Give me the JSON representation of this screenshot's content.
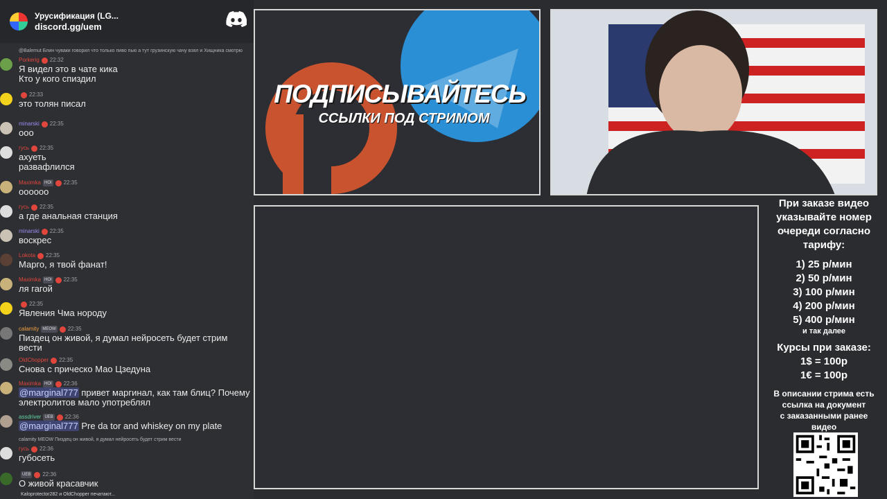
{
  "server": {
    "name": "Урусификация (LG...",
    "invite": "discord.gg/uem",
    "icon": "discord-icon"
  },
  "messages": [
    {
      "reply": "@Balemut Блин чуваки говорил что только пиво пью а тут грузинскую чачу взял и Хищника смотрю",
      "name": "Porkerig",
      "name_color": "#e0463c",
      "time": "22:32",
      "lines": [
        "Я видел это в чате кика",
        "Кто у кого спиздил"
      ]
    },
    {
      "name": "",
      "name_color": "#e6e6e6",
      "time": "22:33",
      "lines": [
        "это толян писал"
      ]
    },
    {
      "name": "minarski",
      "name_color": "#9b8cf0",
      "time": "22:35",
      "lines": [
        "ооо"
      ]
    },
    {
      "name": "гусь",
      "name_color": "#e0463c",
      "time": "22:35",
      "lines": [
        "ахуеть",
        "развафлился"
      ]
    },
    {
      "name": "Maximka",
      "name_color": "#e0463c",
      "badge": "HOI",
      "time": "22:35",
      "lines": [
        "оооооо"
      ]
    },
    {
      "name": "гусь",
      "name_color": "#e0463c",
      "time": "22:35",
      "lines": [
        "а где анальная станция"
      ]
    },
    {
      "name": "minarski",
      "name_color": "#9b8cf0",
      "time": "22:35",
      "lines": [
        "воскрес"
      ]
    },
    {
      "name": "Lokota",
      "name_color": "#e0463c",
      "time": "22:35",
      "lines": [
        "Марго, я твой фанат!"
      ]
    },
    {
      "name": "Maximka",
      "name_color": "#e0463c",
      "badge": "HOI",
      "time": "22:35",
      "lines": [
        "ля гагой"
      ]
    },
    {
      "name": "",
      "name_color": "#e6e6e6",
      "time": "22:35",
      "lines": [
        "Явления Чма нороду"
      ]
    },
    {
      "name": "calamity",
      "name_color": "#f0a040",
      "badge": "MEOW",
      "time": "22:35",
      "lines": [
        "Пиздец он живой, я думал нейросеть будет стрим",
        "вести"
      ]
    },
    {
      "name": "OldChopper",
      "name_color": "#e0463c",
      "time": "22:35",
      "lines": [
        "Снова с прическо Мао Цзедуна"
      ]
    },
    {
      "name": "Maximka",
      "name_color": "#e0463c",
      "badge": "HOI",
      "time": "22:36",
      "mention": "@marginal777",
      "lines": [
        " привет маргинал, как там блиц? Почему",
        "электролитов мало употреблял"
      ]
    },
    {
      "name": "assdriver",
      "name_color": "#5fd3a0",
      "badge": "UEB",
      "time": "22:36",
      "mention": "@marginal777",
      "lines": [
        " Pre da tor and whiskey on my plate"
      ]
    },
    {
      "reply": "calamity MEOW Пиздец он живой, я думал нейросеть будет стрим вести",
      "name": "гусь",
      "name_color": "#e0463c",
      "time": "22:36",
      "lines": [
        "губосеть"
      ]
    },
    {
      "name": "",
      "name_color": "#e6e6e6",
      "badge": "UEB",
      "time": "22:36",
      "lines": [
        "О живой красавчик"
      ]
    }
  ],
  "typing": "Kaloprotector282 и OldChopper печатают...",
  "promo": {
    "title": "ПОДПИСЫВАЙТЕСЬ",
    "subtitle": "ССЫЛКИ ПОД СТРИМОМ"
  },
  "info": {
    "order_text": [
      "При заказе видео",
      "указывайте номер",
      "очереди согласно",
      "тарифу:"
    ],
    "prices": [
      "1) 25 р/мин",
      "2) 50 р/мин",
      "3) 100 р/мин",
      "4) 200 р/мин",
      "5) 400 р/мин"
    ],
    "etc": "и так далее",
    "rates_title": "Курсы при заказе:",
    "rates": [
      "1$ = 100р",
      "1€ = 100р"
    ],
    "doc_text": [
      "В описании стрима есть",
      "ссылка на документ",
      "с заказанными ранее",
      "видео"
    ]
  },
  "colors": {
    "patreon": "#c9532e",
    "telegram": "#2b8fd6",
    "frame": "#d8d8d8"
  }
}
